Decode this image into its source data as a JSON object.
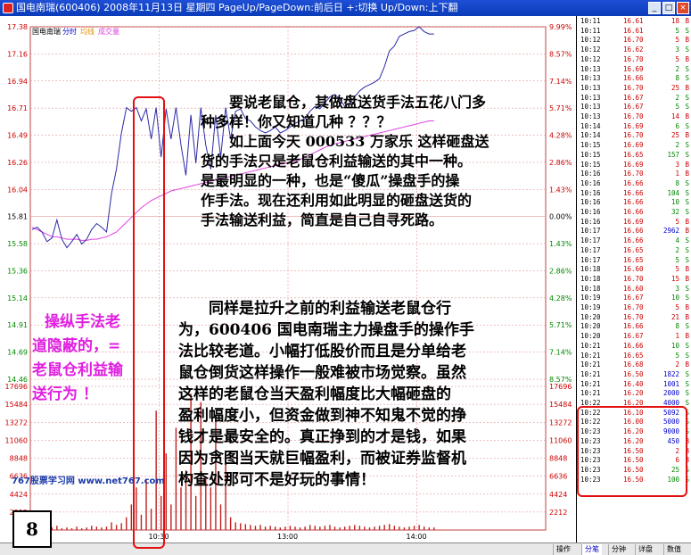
{
  "window": {
    "title": "国电南瑞(600406)  2008年11月13日  星期四  PageUp/PageDown:前后日  +:切换  Up/Down:上下翻",
    "minimize_label": "_",
    "maximize_label": "□",
    "close_label": "×"
  },
  "chart_header": {
    "stock_name": "国电南瑞",
    "tab_fenshi": "分时",
    "tab_junxian": "均线",
    "tab_volume": "成交量"
  },
  "chart_data": {
    "type": "line",
    "price_axis": [
      "17.38",
      "17.16",
      "16.94",
      "16.71",
      "16.49",
      "16.26",
      "16.04",
      "15.81",
      "15.58",
      "15.36",
      "15.14",
      "14.91",
      "14.69",
      "14.46"
    ],
    "pct_axis": [
      "9.99%",
      "8.57%",
      "7.14%",
      "5.71%",
      "4.28%",
      "2.86%",
      "1.43%",
      "0.00%",
      "1.43%",
      "2.86%",
      "4.28%",
      "5.71%",
      "7.14%",
      "8.57%"
    ],
    "volume_axis": [
      "17696",
      "15484",
      "13272",
      "11060",
      "8848",
      "6636",
      "4424",
      "2212"
    ],
    "time_labels": [
      "10:30",
      "13:00",
      "14:00"
    ],
    "ylim": [
      14.46,
      17.38
    ],
    "colors": {
      "price_line": "#2a2aa8",
      "avg_line": "#e040e0",
      "volume_bar": "#c02020",
      "grid": "#e08080"
    },
    "price": [
      15.7,
      15.72,
      15.68,
      15.6,
      15.63,
      15.78,
      15.62,
      15.55,
      15.6,
      15.66,
      15.58,
      15.62,
      15.7,
      15.75,
      15.72,
      15.68,
      16.0,
      16.2,
      16.5,
      16.71,
      16.68,
      16.71,
      16.6,
      16.7,
      16.45,
      16.71,
      16.3,
      16.7,
      16.45,
      16.71,
      16.4,
      16.15,
      16.65,
      16.25,
      16.71,
      16.4,
      16.2,
      16.65,
      16.3,
      16.71,
      16.45,
      16.68,
      16.7,
      16.62,
      16.6,
      16.55,
      16.52,
      16.5,
      16.52,
      16.55,
      16.5,
      16.52,
      16.55,
      16.58,
      16.6,
      16.62,
      16.68,
      16.72,
      16.7,
      16.75,
      16.8,
      16.82,
      16.78,
      16.72,
      16.75,
      16.8,
      16.85,
      16.88,
      16.9,
      16.92,
      16.95,
      17.05,
      17.18,
      17.22,
      17.3,
      17.32,
      17.34,
      17.35,
      17.38,
      17.34,
      17.32,
      17.32
    ],
    "avg": [
      15.72,
      15.7,
      15.68,
      15.66,
      15.64,
      15.64,
      15.63,
      15.62,
      15.62,
      15.62,
      15.61,
      15.61,
      15.62,
      15.62,
      15.63,
      15.64,
      15.66,
      15.68,
      15.72,
      15.76,
      15.8,
      15.84,
      15.88,
      15.91,
      15.94,
      15.96,
      15.98,
      16.0,
      16.02,
      16.03,
      16.04,
      16.05,
      16.06,
      16.07,
      16.08,
      16.09,
      16.1,
      16.11,
      16.12,
      16.13,
      16.14,
      16.15,
      16.16,
      16.17,
      16.18,
      16.19,
      16.2,
      16.21,
      16.22,
      16.23,
      16.24,
      16.25,
      16.26,
      16.27,
      16.28,
      16.3,
      16.32,
      16.34,
      16.36,
      16.38,
      16.4,
      16.41,
      16.42,
      16.43,
      16.44,
      16.45,
      16.46,
      16.47,
      16.48,
      16.49,
      16.5,
      16.51,
      16.52,
      16.53,
      16.54,
      16.55,
      16.56,
      16.57,
      16.58,
      16.59,
      16.6,
      16.6
    ],
    "volume": [
      600,
      400,
      300,
      1200,
      300,
      500,
      200,
      300,
      200,
      400,
      200,
      300,
      500,
      400,
      300,
      400,
      900,
      600,
      800,
      1500,
      3000,
      5000,
      1800,
      6000,
      2500,
      14000,
      4000,
      9000,
      3000,
      12000,
      5000,
      7000,
      16000,
      4000,
      15000,
      6000,
      5000,
      13000,
      3000,
      9000,
      1500,
      900,
      800,
      700,
      600,
      500,
      600,
      400,
      500,
      400,
      300,
      400,
      500,
      400,
      300,
      400,
      600,
      500,
      400,
      500,
      600,
      400,
      300,
      400,
      500,
      600,
      500,
      400,
      300,
      400,
      500,
      600,
      700,
      500,
      400,
      300,
      400,
      500,
      600,
      400,
      300,
      300
    ]
  },
  "overlay": {
    "para1": [
      "　　要说老鼠仓，其做盘送货手法五花八门多",
      "种多样！你又知道几种 ？？？",
      "　　如上面今天 000533 万家乐 这样砸盘送",
      "货的手法只是老鼠仓利益输送的其中一种。",
      "是最明显的一种，也是“傻瓜”操盘手的操",
      "作手法。现在还利用如此明显的砸盘送货的",
      "手法输送利益，简直是自己自寻死路。"
    ],
    "para2": [
      "　　同样是拉升之前的利益输送老鼠仓行",
      "为，600406 国电南瑞主力操盘手的操作手",
      "法比较老道。小幅打低股价而且是分单给老",
      "鼠仓倒货这样操作一般难被市场觉察。虽然",
      "这样的老鼠仓当天盈利幅度比大幅砸盘的",
      "盈利幅度小，但资金做到神不知鬼不觉的挣",
      "钱才是最安全的。真正挣到的才是钱，如果",
      "因为贪图当天就巨幅盈利，而被证券监督机",
      "构查处那可不是好玩的事情！"
    ],
    "magenta": [
      "操纵手法老",
      "道隐蔽的，=",
      "老鼠仓利益输",
      "送行为 ！"
    ],
    "watermark": "767股票学习网  www.net767.com",
    "page_number": "8"
  },
  "ticks": [
    {
      "t": "10:11",
      "p": "16.61",
      "v": "18",
      "d": "B"
    },
    {
      "t": "10:11",
      "p": "16.61",
      "v": "5",
      "d": "S"
    },
    {
      "t": "10:12",
      "p": "16.70",
      "v": "5",
      "d": "B"
    },
    {
      "t": "10:12",
      "p": "16.62",
      "v": "3",
      "d": "S"
    },
    {
      "t": "10:12",
      "p": "16.70",
      "v": "5",
      "d": "B"
    },
    {
      "t": "10:13",
      "p": "16.69",
      "v": "2",
      "d": "S"
    },
    {
      "t": "10:13",
      "p": "16.66",
      "v": "8",
      "d": "S"
    },
    {
      "t": "10:13",
      "p": "16.70",
      "v": "25",
      "d": "B"
    },
    {
      "t": "10:13",
      "p": "16.67",
      "v": "2",
      "d": "S"
    },
    {
      "t": "10:13",
      "p": "16.67",
      "v": "5",
      "d": "S"
    },
    {
      "t": "10:13",
      "p": "16.70",
      "v": "14",
      "d": "B"
    },
    {
      "t": "10:14",
      "p": "16.69",
      "v": "6",
      "d": "S"
    },
    {
      "t": "10:14",
      "p": "16.70",
      "v": "25",
      "d": "B"
    },
    {
      "t": "10:15",
      "p": "16.69",
      "v": "2",
      "d": "S"
    },
    {
      "t": "10:15",
      "p": "16.65",
      "v": "157",
      "d": "S"
    },
    {
      "t": "10:15",
      "p": "16.69",
      "v": "3",
      "d": "B"
    },
    {
      "t": "10:16",
      "p": "16.70",
      "v": "1",
      "d": "B"
    },
    {
      "t": "10:16",
      "p": "16.66",
      "v": "8",
      "d": "S"
    },
    {
      "t": "10:16",
      "p": "16.66",
      "v": "104",
      "d": "S"
    },
    {
      "t": "10:16",
      "p": "16.66",
      "v": "10",
      "d": "S"
    },
    {
      "t": "10:16",
      "p": "16.66",
      "v": "32",
      "d": "S"
    },
    {
      "t": "10:16",
      "p": "16.69",
      "v": "5",
      "d": "B"
    },
    {
      "t": "10:17",
      "p": "16.66",
      "v": "2962",
      "d": "B"
    },
    {
      "t": "10:17",
      "p": "16.66",
      "v": "4",
      "d": "S"
    },
    {
      "t": "10:17",
      "p": "16.65",
      "v": "2",
      "d": "S"
    },
    {
      "t": "10:17",
      "p": "16.65",
      "v": "5",
      "d": "S"
    },
    {
      "t": "10:18",
      "p": "16.60",
      "v": "5",
      "d": "B"
    },
    {
      "t": "10:18",
      "p": "16.70",
      "v": "15",
      "d": "B"
    },
    {
      "t": "10:18",
      "p": "16.60",
      "v": "3",
      "d": "S"
    },
    {
      "t": "10:19",
      "p": "16.67",
      "v": "10",
      "d": "S"
    },
    {
      "t": "10:19",
      "p": "16.70",
      "v": "5",
      "d": "B"
    },
    {
      "t": "10:20",
      "p": "16.70",
      "v": "21",
      "d": "B"
    },
    {
      "t": "10:20",
      "p": "16.66",
      "v": "8",
      "d": "S"
    },
    {
      "t": "10:20",
      "p": "16.67",
      "v": "1",
      "d": "B"
    },
    {
      "t": "10:21",
      "p": "16.66",
      "v": "10",
      "d": "S"
    },
    {
      "t": "10:21",
      "p": "16.65",
      "v": "5",
      "d": "S"
    },
    {
      "t": "10:21",
      "p": "16.68",
      "v": "2",
      "d": "B"
    },
    {
      "t": "10:21",
      "p": "16.50",
      "v": "1822",
      "d": "S"
    },
    {
      "t": "10:21",
      "p": "16.40",
      "v": "1001",
      "d": "S"
    },
    {
      "t": "10:21",
      "p": "16.20",
      "v": "2000",
      "d": "S"
    },
    {
      "t": "10:22",
      "p": "16.20",
      "v": "4000",
      "d": "S"
    },
    {
      "t": "10:22",
      "p": "16.10",
      "v": "5092",
      "d": "S"
    },
    {
      "t": "10:22",
      "p": "16.00",
      "v": "5000",
      "d": "S"
    },
    {
      "t": "10:23",
      "p": "16.20",
      "v": "9000",
      "d": "S"
    },
    {
      "t": "10:23",
      "p": "16.20",
      "v": "450",
      "d": "B"
    },
    {
      "t": "10:23",
      "p": "16.50",
      "v": "2",
      "d": "B"
    },
    {
      "t": "10:23",
      "p": "16.50",
      "v": "6",
      "d": "B"
    },
    {
      "t": "10:23",
      "p": "16.50",
      "v": "25",
      "d": "S"
    },
    {
      "t": "10:23",
      "p": "16.50",
      "v": "100",
      "d": "S"
    }
  ],
  "bottom_tabs": [
    "操作",
    "分笔",
    "分钟",
    "详盘",
    "数值"
  ]
}
